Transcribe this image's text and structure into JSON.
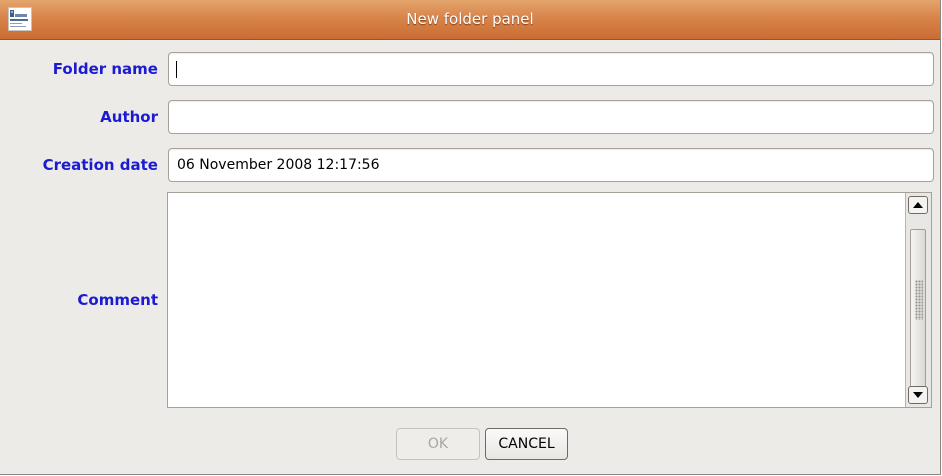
{
  "window": {
    "title": "New folder panel",
    "icon": "app-logo-icon"
  },
  "form": {
    "folder_name": {
      "label": "Folder name",
      "value": ""
    },
    "author": {
      "label": "Author",
      "value": ""
    },
    "creation_date": {
      "label": "Creation date",
      "value": "06 November 2008 12:17:56"
    },
    "comment": {
      "label": "Comment",
      "value": ""
    }
  },
  "buttons": {
    "ok": "OK",
    "cancel": "CANCEL"
  },
  "colors": {
    "label": "#1b1bd1",
    "titlebar": "#d8844a",
    "panel": "#edebe8"
  }
}
